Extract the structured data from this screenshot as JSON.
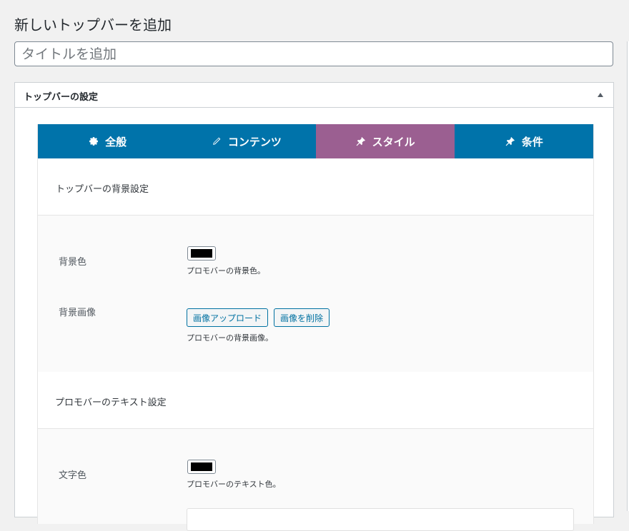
{
  "page": {
    "title": "新しいトップバーを追加",
    "title_input_placeholder": "タイトルを追加"
  },
  "metabox": {
    "title": "トップバーの設定",
    "toggle_icon": "triangle-up-icon"
  },
  "tabs": [
    {
      "label": "全般",
      "icon": "gear-icon"
    },
    {
      "label": "コンテンツ",
      "icon": "pencil-icon"
    },
    {
      "label": "スタイル",
      "icon": "pushpin-icon",
      "active": true
    },
    {
      "label": "条件",
      "icon": "pushpin-icon"
    }
  ],
  "colors": {
    "tab_bg": "#0073aa",
    "tab_active_bg": "#9b5f91",
    "button_accent": "#0071a1",
    "swatch_color": "#000000"
  },
  "background_section": {
    "heading": "トップバーの背景設定",
    "bg_color": {
      "label": "背景色",
      "description": "プロモバーの背景色。"
    },
    "bg_image": {
      "label": "背景画像",
      "upload_button": "画像アップロード",
      "remove_button": "画像を削除",
      "description": "プロモバーの背景画像。"
    }
  },
  "text_section": {
    "heading": "プロモバーのテキスト設定",
    "text_color": {
      "label": "文字色",
      "description": "プロモバーのテキスト色。"
    }
  }
}
